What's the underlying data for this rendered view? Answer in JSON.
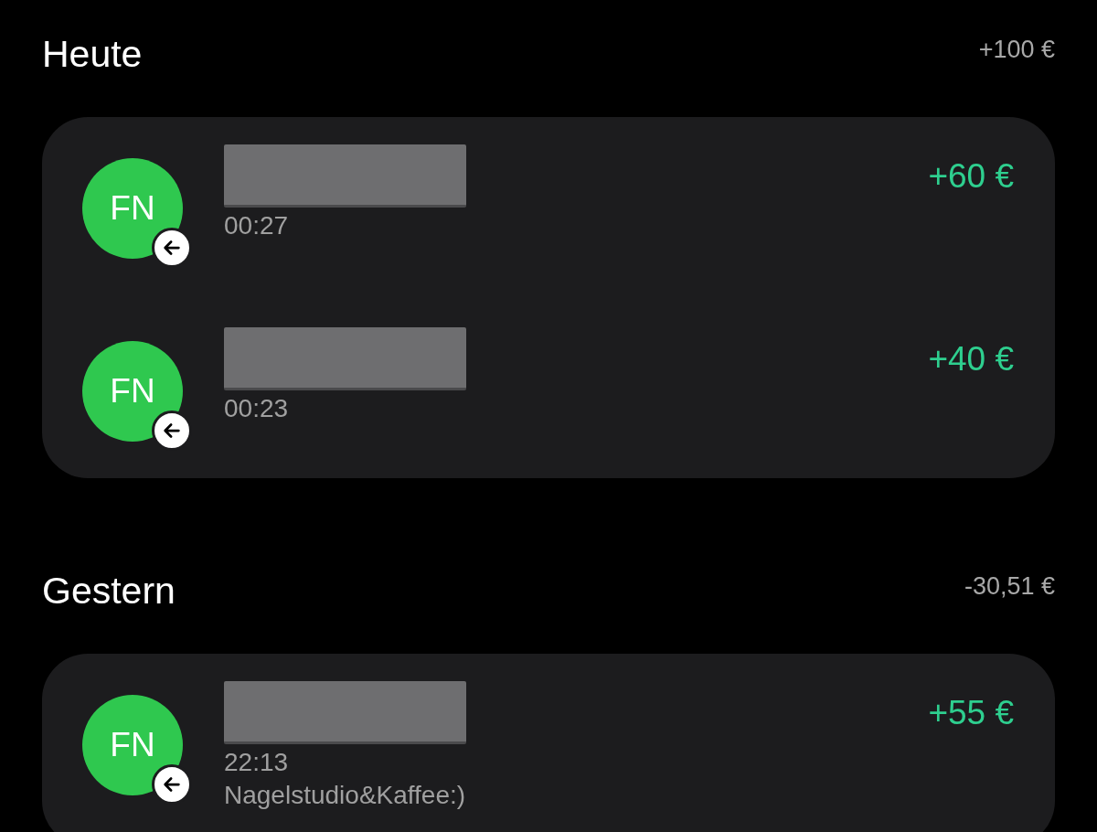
{
  "sections": [
    {
      "title": "Heute",
      "total": "+100 €",
      "transactions": [
        {
          "initials": "FN",
          "name_redacted": true,
          "time": "00:27",
          "amount": "+60 €"
        },
        {
          "initials": "FN",
          "name_redacted": true,
          "time": "00:23",
          "amount": "+40 €"
        }
      ]
    },
    {
      "title": "Gestern",
      "total": "-30,51 €",
      "transactions": [
        {
          "initials": "FN",
          "name_redacted": true,
          "time": "22:13",
          "note": "Nagelstudio&Kaffee:)",
          "amount": "+55 €"
        }
      ]
    }
  ]
}
